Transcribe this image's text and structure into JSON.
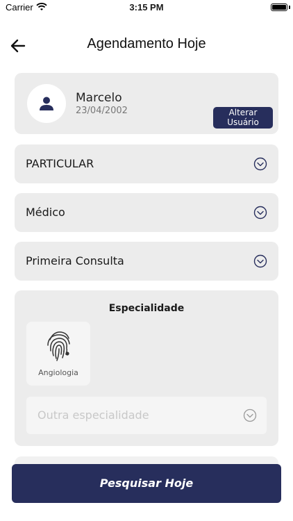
{
  "status_bar": {
    "carrier": "Carrier",
    "time": "3:15 PM"
  },
  "nav": {
    "title": "Agendamento Hoje",
    "back_icon": "arrow-left-icon"
  },
  "user": {
    "name": "Marcelo",
    "birth_date": "23/04/2002",
    "avatar_icon": "person-icon",
    "change_button_line1": "Alterar",
    "change_button_line2": "Usuário"
  },
  "selects": [
    {
      "label": "PARTICULAR"
    },
    {
      "label": "Médico"
    },
    {
      "label": "Primeira Consulta"
    }
  ],
  "specialty": {
    "title": "Especialidade",
    "tiles": [
      {
        "label": "Angiologia",
        "icon": "fingerprint-icon"
      }
    ],
    "other_placeholder": "Outra especialidade"
  },
  "actions": {
    "search_label": "Pesquisar Hoje"
  },
  "colors": {
    "primary": "#272e5c",
    "card_bg": "#ececec"
  }
}
